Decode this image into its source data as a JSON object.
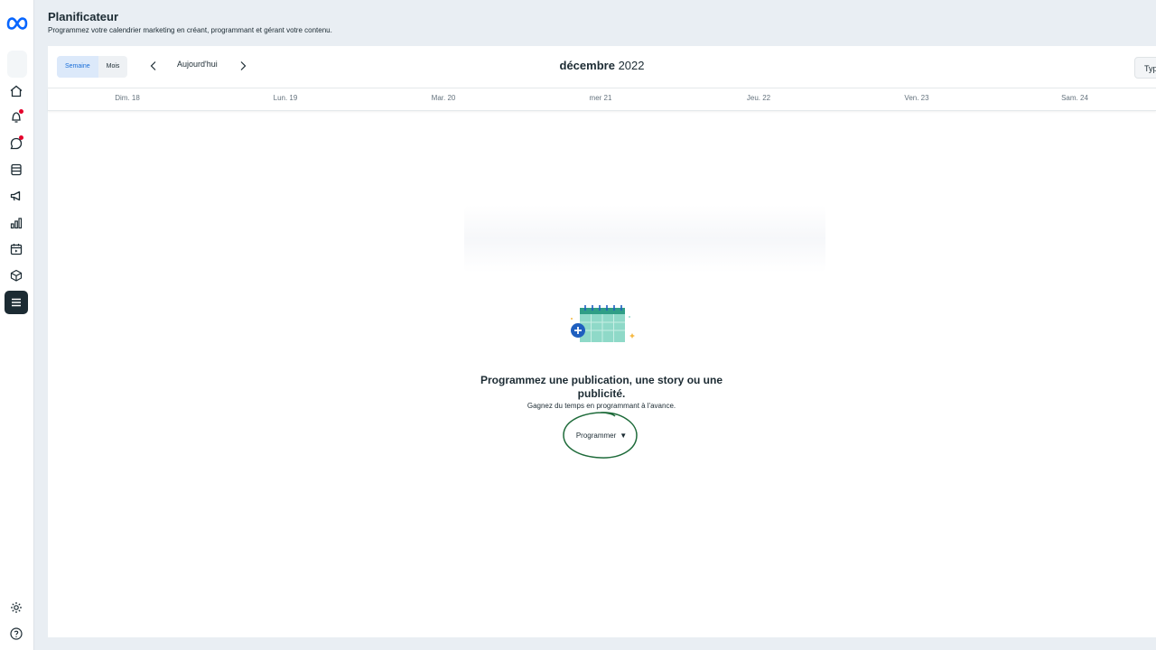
{
  "header": {
    "title": "Planificateur",
    "subtitle": "Programmez votre calendrier marketing en créant, programmant et gérant votre contenu."
  },
  "sidebar": {
    "icons": [
      "meta-logo-icon",
      "home-icon",
      "notifications-icon",
      "messages-icon",
      "content-icon",
      "ads-icon",
      "insights-icon",
      "planner-icon",
      "inventory-icon",
      "menu-icon",
      "settings-icon",
      "help-icon"
    ]
  },
  "toolbar": {
    "view_week": "Semaine",
    "view_month": "Mois",
    "today": "Aujourd'hui",
    "month_bold": "décembre",
    "year": "2022",
    "type_label": "Typ"
  },
  "days": [
    "Dim. 18",
    "Lun. 19",
    "Mar. 20",
    "mer 21",
    "Jeu. 22",
    "Ven. 23",
    "Sam. 24"
  ],
  "empty_state": {
    "title": "Programmez une publication, une story ou une publicité.",
    "subtitle": "Gagnez du temps en programmant à l'avance.",
    "button": "Programmer"
  },
  "colors": {
    "accent": "#1a6ed8",
    "rail_active": "#1c2b33",
    "highlight": "#1e6b3a",
    "calendar_teal": "#8fd9c8",
    "calendar_header": "#2f9e86",
    "plus_blue": "#1f5fbf"
  }
}
